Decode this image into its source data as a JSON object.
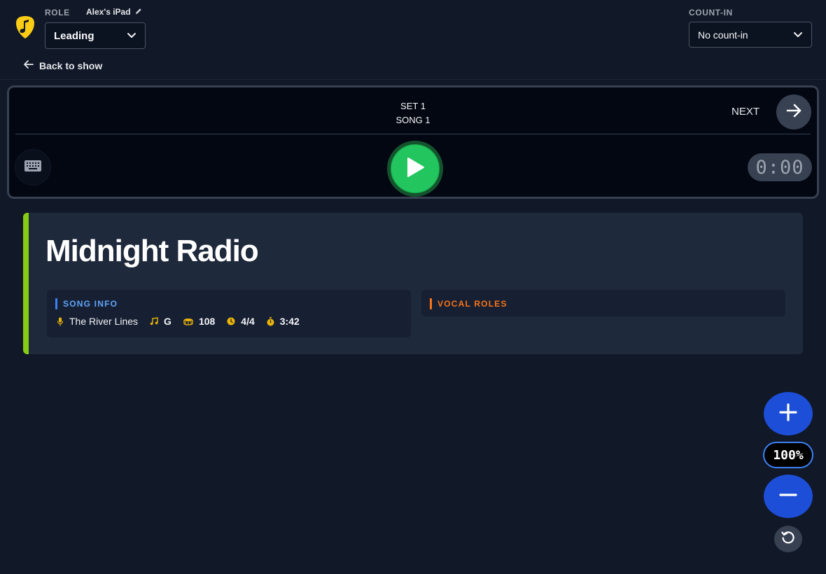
{
  "header": {
    "role_label": "ROLE",
    "device_name": "Alex's iPad",
    "role_value": "Leading",
    "countin_label": "COUNT-IN",
    "countin_value": "No count-in",
    "back_label": "Back to show"
  },
  "transport": {
    "set_label": "SET 1",
    "song_label": "SONG 1",
    "next_label": "NEXT",
    "timer": "0:00"
  },
  "song": {
    "title": "Midnight Radio",
    "accent_color": "#84cc16",
    "info_heading": "SONG INFO",
    "artist": "The River Lines",
    "key": "G",
    "bpm": "108",
    "time_signature": "4/4",
    "duration": "3:42",
    "vocal_heading": "VOCAL ROLES"
  },
  "zoom": {
    "level": "100%"
  },
  "colors": {
    "info_heading": "#60a5fa",
    "vocal_heading": "#f97316",
    "play": "#22c55e",
    "zoom": "#1d4ed8"
  }
}
